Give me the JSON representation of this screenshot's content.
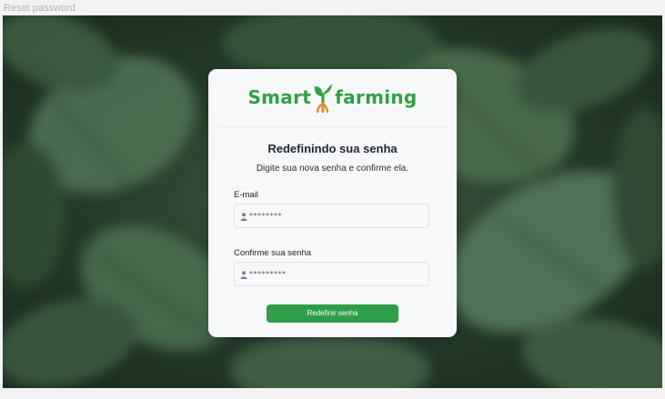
{
  "frame": {
    "label": "Reset password"
  },
  "logo": {
    "word_left": "Smart",
    "word_right": "farming"
  },
  "form": {
    "title": "Redefinindo sua senha",
    "subtitle": "Digite sua nova senha e confirme ela.",
    "email": {
      "label": "E-mail",
      "value": "********",
      "icon": "user-icon"
    },
    "confirm": {
      "label": "Confirme sua senha",
      "value": "*********",
      "icon": "user-icon"
    },
    "submit_label": "Redefinir senha"
  },
  "colors": {
    "brand_green": "#33a046",
    "button_green": "#2e9e49",
    "sprout_root": "#e98a2c",
    "card_bg": "#f7f8f9"
  }
}
